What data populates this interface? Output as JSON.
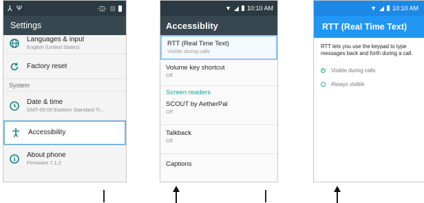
{
  "screen1": {
    "status_icons": [
      "network-icon",
      "wifi-icon",
      "vibrate-icon",
      "sim-icon",
      "battery-icon"
    ],
    "title": "Settings",
    "items": [
      {
        "title": "Languages & input",
        "subtitle": "English (United States)",
        "icon": "globe-icon"
      },
      {
        "title": "Factory reset",
        "subtitle": "",
        "icon": "reset-icon"
      },
      {
        "title": "Date & time",
        "subtitle": "GMT-05:00 Eastern Standard Ti...",
        "icon": "clock-icon"
      },
      {
        "title": "Accessibility",
        "subtitle": "",
        "icon": "accessibility-icon"
      },
      {
        "title": "About phone",
        "subtitle": "Firmware 7.1.2",
        "icon": "info-icon"
      }
    ],
    "section_system": "System"
  },
  "screen2": {
    "time": "10:10 AM",
    "title": "Accessiblity",
    "items": [
      {
        "title": "RTT (Real Time Text)",
        "subtitle": "Visible during calls"
      },
      {
        "title": "Volume key shortcut",
        "subtitle": "Off"
      },
      {
        "title": "SCOUT by AetherPal",
        "subtitle": "Off"
      },
      {
        "title": "Talkback",
        "subtitle": "Off"
      },
      {
        "title": "Captions",
        "subtitle": ""
      }
    ],
    "section_screen_readers": "Screen readers"
  },
  "screen3": {
    "time": "10:10 AM",
    "title": "RTT (Real Time Text)",
    "description": "RTT lets you use the keypad to type messages back and forth during a call.",
    "options": [
      {
        "label": "Visible during calls",
        "selected": true
      },
      {
        "label": "Always visible",
        "selected": false
      }
    ]
  },
  "colors": {
    "dark_bar": "#37474f",
    "blue_bar": "#2196f3",
    "teal": "#16867c",
    "highlight": "#78b8d8"
  }
}
